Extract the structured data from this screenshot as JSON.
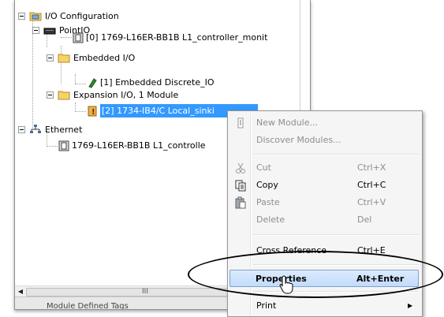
{
  "tree": {
    "items": [
      {
        "label": "I/O Configuration",
        "icon": "folder-icon"
      },
      {
        "label": "PointIO",
        "icon": "backplane-icon"
      },
      {
        "label": "[0] 1769-L16ER-BB1B L1_controller_monit",
        "icon": "module-icon"
      },
      {
        "label": "Embedded I/O",
        "icon": "folder-icon"
      },
      {
        "label": "[1] Embedded Discrete_IO",
        "icon": "io-module-icon"
      },
      {
        "label": "Expansion I/O, 1 Module",
        "icon": "folder-icon"
      },
      {
        "label": "[2] 1734-IB4/C Local_sinki",
        "icon": "warning-module-icon"
      },
      {
        "label": "Ethernet",
        "icon": "network-icon"
      },
      {
        "label": "1769-L16ER-BB1B L1_controlle",
        "icon": "module-icon"
      }
    ],
    "scroll_thumb_label": "III",
    "bottom_label": "Module Defined Tags"
  },
  "context_menu": {
    "items": [
      {
        "label": "New Module...",
        "shortcut": "",
        "enabled": false,
        "icon": "new-module-icon"
      },
      {
        "label": "Discover Modules...",
        "shortcut": "",
        "enabled": false,
        "icon": ""
      },
      {
        "label": "Cut",
        "shortcut": "Ctrl+X",
        "enabled": false,
        "icon": "cut-icon"
      },
      {
        "label": "Copy",
        "shortcut": "Ctrl+C",
        "enabled": true,
        "icon": "copy-icon"
      },
      {
        "label": "Paste",
        "shortcut": "Ctrl+V",
        "enabled": false,
        "icon": "paste-icon"
      },
      {
        "label": "Delete",
        "shortcut": "Del",
        "enabled": false,
        "icon": ""
      },
      {
        "label": "Cross Reference",
        "shortcut": "Ctrl+E",
        "enabled": true,
        "icon": ""
      },
      {
        "label": "Properties",
        "shortcut": "Alt+Enter",
        "enabled": true,
        "icon": ""
      },
      {
        "label": "Print",
        "shortcut": "",
        "enabled": true,
        "icon": ""
      }
    ]
  },
  "colors": {
    "selection": "#3399ff",
    "menu_hover": "#c1dbfc"
  }
}
